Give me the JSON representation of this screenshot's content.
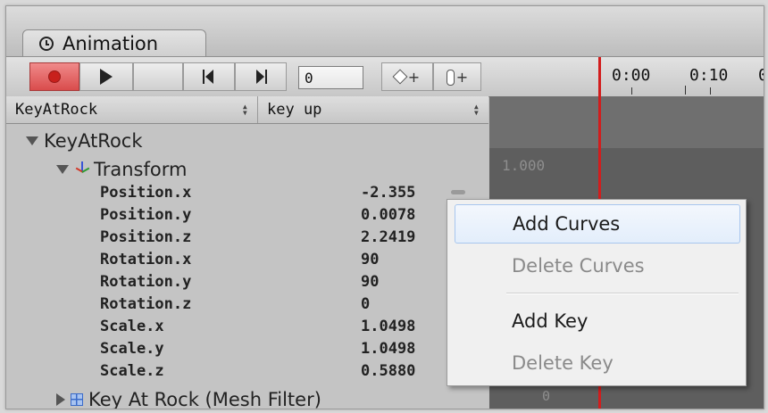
{
  "tab": {
    "title": "Animation",
    "icon": "clock-icon"
  },
  "toolbar": {
    "record_icon": "record-icon",
    "play_icon": "play-icon",
    "prev_key_icon": "previous-keyframe-icon",
    "next_key_icon": "next-keyframe-icon",
    "frame_value": "0",
    "add_keyframe_icon": "add-keyframe-icon",
    "add_event_icon": "add-event-icon"
  },
  "timeline": {
    "ticks": [
      "0:00",
      "0:10",
      "0"
    ]
  },
  "header": {
    "object": "KeyAtRock",
    "clip": "key up"
  },
  "tree": {
    "root": "KeyAtRock",
    "transform": "Transform",
    "mesh_filter": "Key At Rock (Mesh Filter)"
  },
  "properties": [
    {
      "name": "Position.x",
      "value": "-2.355"
    },
    {
      "name": "Position.y",
      "value": "0.0078"
    },
    {
      "name": "Position.z",
      "value": "2.2419"
    },
    {
      "name": "Rotation.x",
      "value": "90"
    },
    {
      "name": "Rotation.y",
      "value": "90"
    },
    {
      "name": "Rotation.z",
      "value": "0"
    },
    {
      "name": "Scale.x",
      "value": "1.0498"
    },
    {
      "name": "Scale.y",
      "value": "1.0498"
    },
    {
      "name": "Scale.z",
      "value": "0.5880"
    }
  ],
  "curve_view": {
    "scale_label": "1.000",
    "zero_label": "0"
  },
  "context_menu": {
    "add_curves": "Add Curves",
    "delete_curves": "Delete Curves",
    "add_key": "Add Key",
    "delete_key": "Delete Key"
  },
  "colors": {
    "playhead": "#d21d1d",
    "record": "#d94c4c",
    "highlight": "#e3eefb"
  }
}
